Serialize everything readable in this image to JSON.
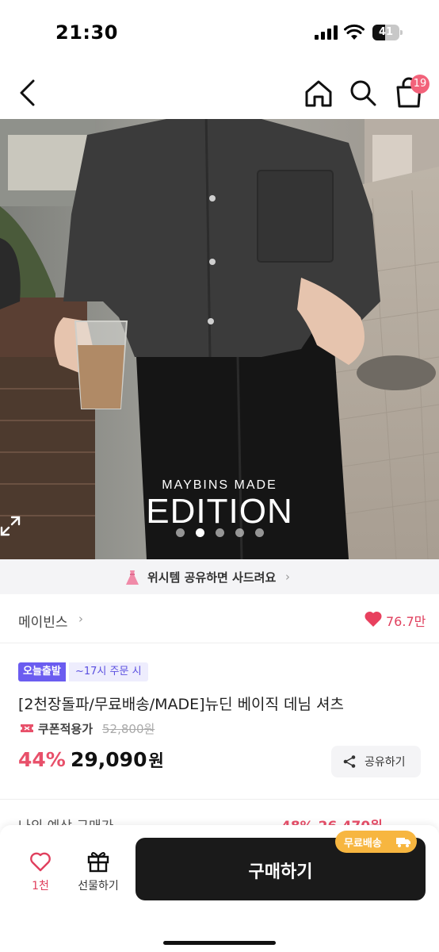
{
  "status_bar": {
    "time": "21:30",
    "battery": "41"
  },
  "nav": {
    "cart_count": "19"
  },
  "hero": {
    "brand_small": "MAYBINS MADE",
    "brand_big": "EDITION",
    "slide_count": 5,
    "active_slide": 1
  },
  "wish_banner": {
    "text": "위시템 공유하면 사드려요"
  },
  "store": {
    "name": "메이빈스",
    "likes": "76.7만"
  },
  "product": {
    "tag_today": "오늘출발",
    "tag_time": "~17시 주문 시",
    "title": "[2천장돌파/무료배송/MADE]뉴딘 베이직 데님 셔츠",
    "coupon_label": "쿠폰적용가",
    "original_price": "52,800원",
    "discount": "44%",
    "price": "29,090",
    "price_unit": "원",
    "share_label": "공유하기"
  },
  "peek": {
    "left": "나의 예상 구매가",
    "right": "48% 26,470원"
  },
  "bottom_bar": {
    "like_count": "1천",
    "gift_label": "선물하기",
    "buy_label": "구매하기",
    "free_shipping": "무료배송"
  },
  "colors": {
    "accent_pink": "#e8506a",
    "badge_purple": "#6b5cf0",
    "buy_button": "#1a1a1a",
    "free_badge": "#f7b640"
  }
}
